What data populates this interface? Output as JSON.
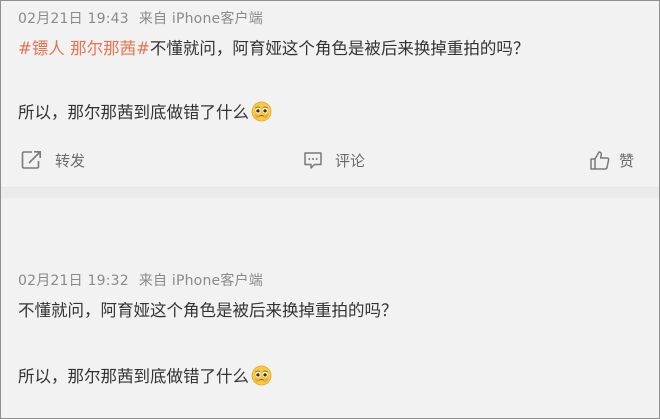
{
  "posts": [
    {
      "time": "02月21日 19:43",
      "source": "来自 iPhone客户端",
      "topic": "#镖人 那尔那茜#",
      "line1": "不懂就问，阿育娅这个角色是被后来换掉重拍的吗？",
      "line2": "所以，那尔那茜到底做错了什么",
      "emoji": "pleading-face-emoji",
      "actions": {
        "repost": "转发",
        "comment": "评论",
        "like": "赞"
      }
    },
    {
      "time": "02月21日 19:32",
      "source": "来自 iPhone客户端",
      "line1": "不懂就问，阿育娅这个角色是被后来换掉重拍的吗？",
      "line2": "所以，那尔那茜到底做错了什么",
      "emoji": "pleading-face-emoji"
    }
  ],
  "colors": {
    "topic": "#eb7350",
    "meta": "#8a8a8a",
    "text": "#333333",
    "background": "#f2f2f2"
  }
}
